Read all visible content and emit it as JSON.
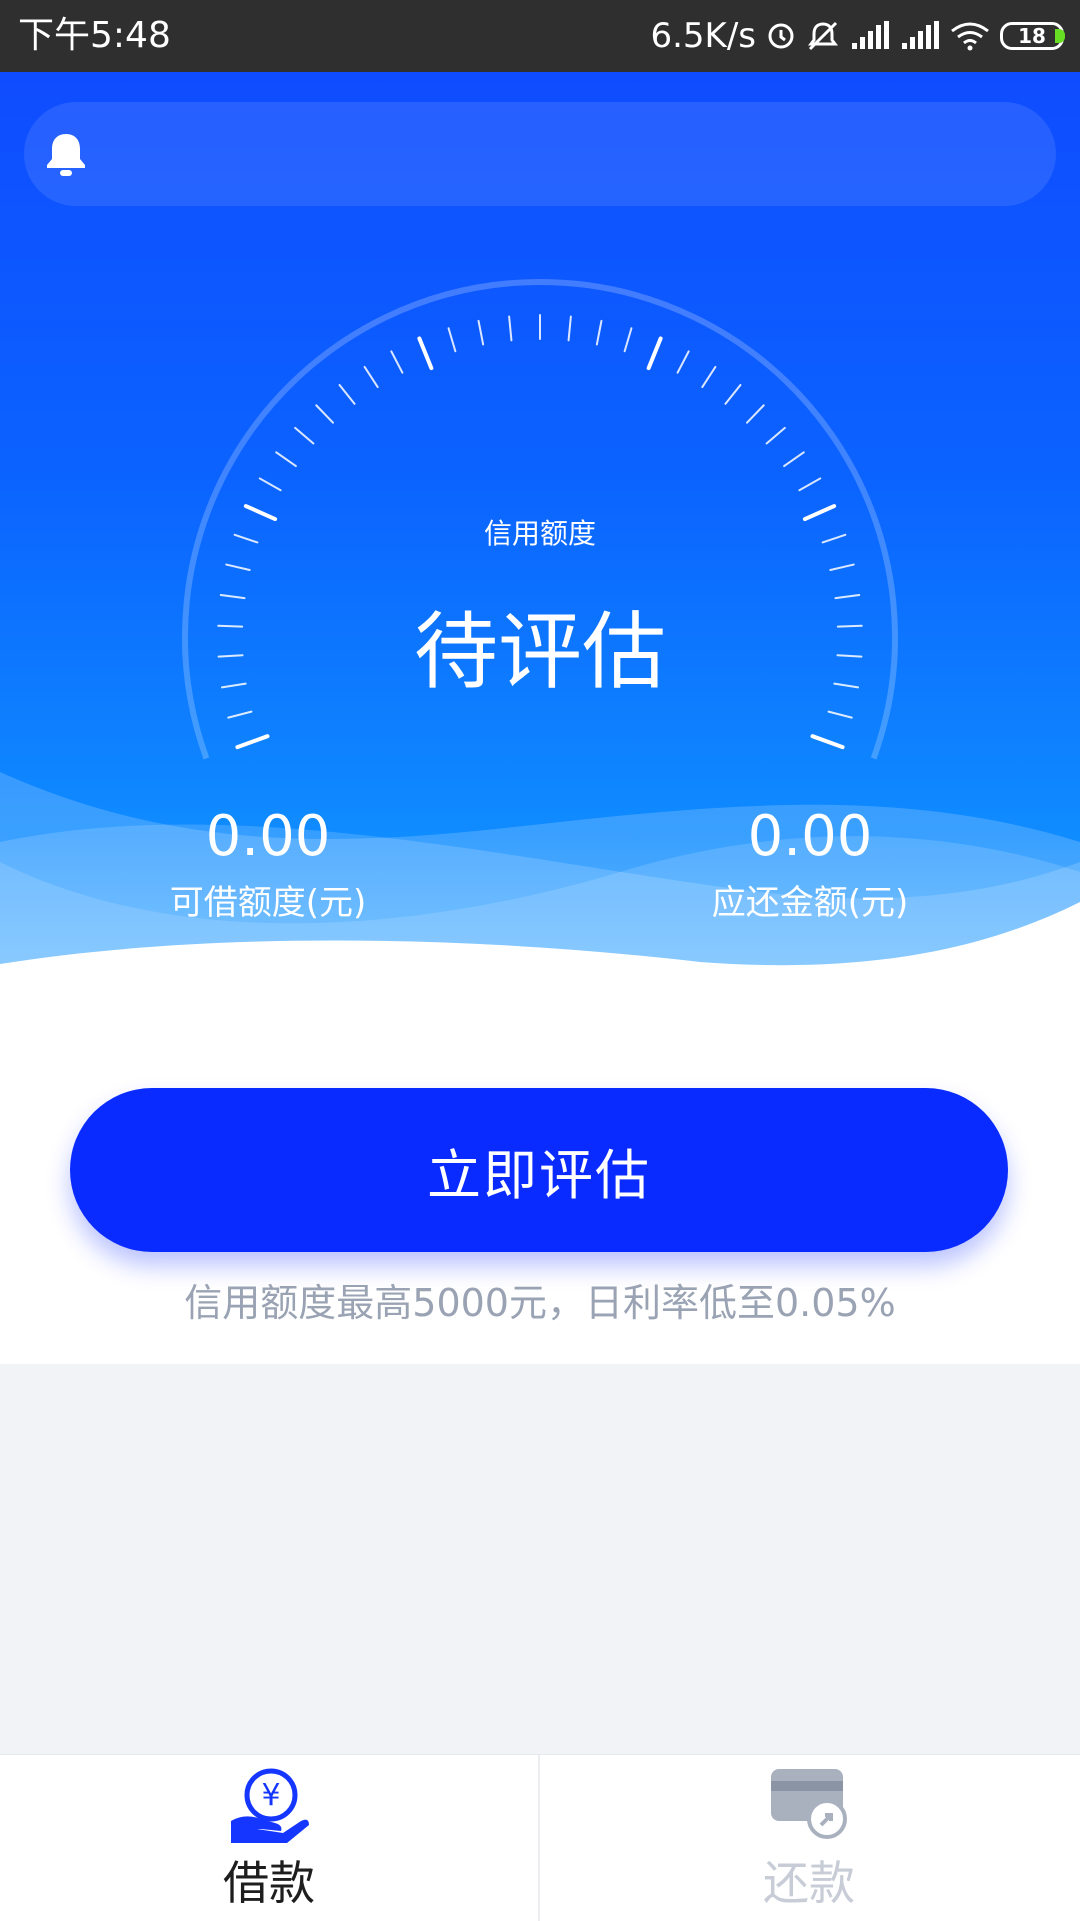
{
  "status_bar": {
    "time": "下午5:48",
    "network_speed": "6.5K/s",
    "battery": "18",
    "icons": [
      "sync-icon",
      "mute-icon",
      "signal-icon",
      "signal-icon",
      "wifi-icon",
      "battery-icon"
    ]
  },
  "notice": {
    "icon": "bell-icon"
  },
  "gauge": {
    "label": "信用额度",
    "value": "待评估"
  },
  "stats": {
    "available": {
      "value": "0.00",
      "label": "可借额度(元)"
    },
    "due": {
      "value": "0.00",
      "label": "应还金额(元)"
    }
  },
  "cta": {
    "button_label": "立即评估",
    "note": "信用额度最高5000元，日利率低至0.05%"
  },
  "bottom_nav": {
    "items": [
      {
        "label": "借款",
        "icon": "loan-hand-yen-icon",
        "active": true
      },
      {
        "label": "还款",
        "icon": "card-repay-icon",
        "active": false
      }
    ]
  },
  "colors": {
    "primary": "#0a2bff",
    "hero_top": "#0f4cff",
    "hero_bottom": "#3aa8ff",
    "muted_text": "#9aa3b3",
    "inactive_nav": "#c7ccd6"
  }
}
